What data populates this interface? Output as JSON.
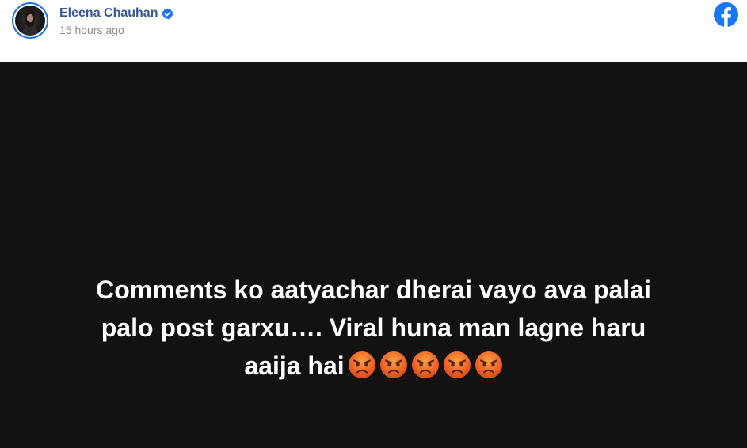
{
  "post": {
    "author": {
      "name": "Eleena Chauhan",
      "verified": true
    },
    "timestamp": "15 hours ago",
    "platform_icon": "facebook-icon",
    "text_lines": [
      "Comments ko aatyachar dherai vayo ava palai",
      "palo post garxu…. Viral huna man lagne haru",
      "aaija hai"
    ],
    "emoji": {
      "name": "angry-face-emoji",
      "count": 5
    },
    "background_color": "#121212",
    "text_color": "#ffffff"
  },
  "colors": {
    "author_name": "#385898",
    "timestamp": "#8a8d91",
    "facebook_blue": "#1877f2",
    "verified_blue": "#1b74e4"
  }
}
